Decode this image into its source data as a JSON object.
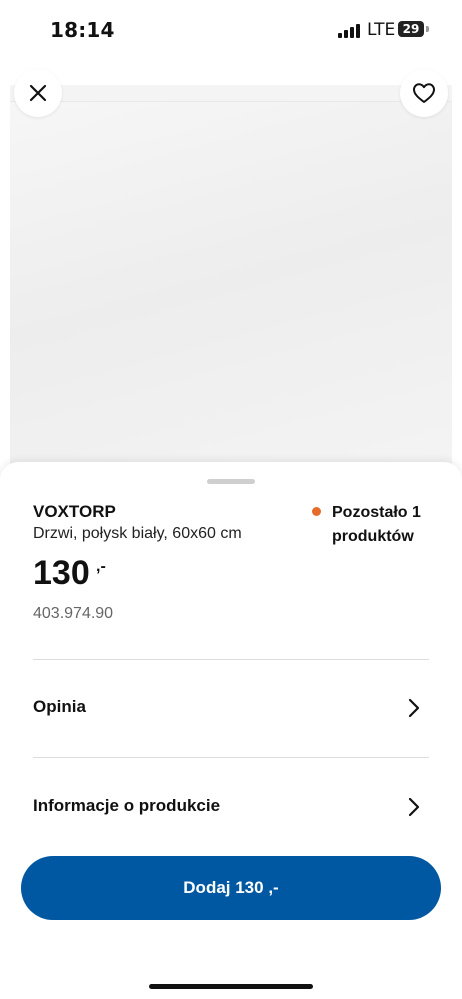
{
  "status_bar": {
    "time": "18:14",
    "network": "LTE",
    "battery": "29"
  },
  "product": {
    "name": "VOXTORP",
    "description": "Drzwi, połysk biały, 60x60 cm",
    "price": "130",
    "price_suffix": ",-",
    "article_number": "403.974.90",
    "stock": "Pozostało 1 produktów",
    "stock_color": "#e56d2c"
  },
  "rows": [
    {
      "label": "Opinia"
    },
    {
      "label": "Informacje o produkcie"
    }
  ],
  "add_button": {
    "label": "Dodaj 130 ,-",
    "color": "#0058a3"
  },
  "icons": {
    "close": "close-icon",
    "favorite": "heart-icon",
    "chevron": "chevron-right-icon"
  }
}
